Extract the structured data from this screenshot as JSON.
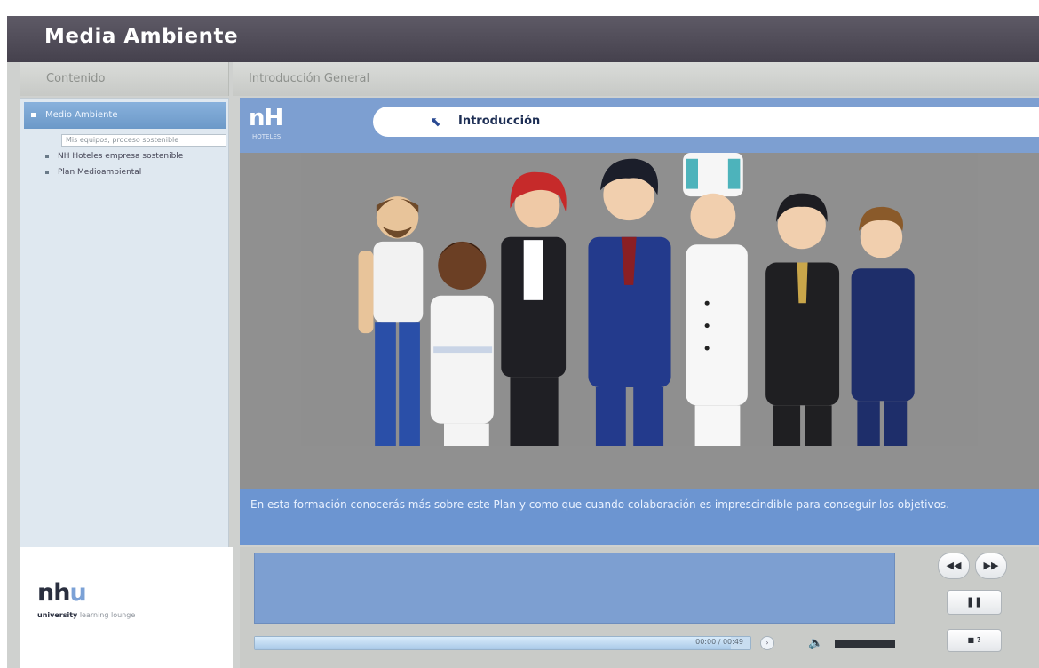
{
  "window": {
    "title": "Media Ambiente"
  },
  "sidebar": {
    "header": "Contenido",
    "root_label": "Medio Ambiente",
    "search_value": "Mis equipos, proceso sostenible",
    "items": [
      {
        "label": "NH Hoteles empresa sostenible"
      },
      {
        "label": "Plan Medioambiental"
      }
    ]
  },
  "content": {
    "header": "Introducción General",
    "breadcrumb": "Introducción",
    "caption": "En esta formación conocerás más sobre este Plan y como que cuando colaboración es imprescindible para conseguir los objetivos."
  },
  "branding": {
    "logo_text": "nh",
    "logo_accent": "u",
    "sub_bold": "university",
    "sub_rest": "learning lounge"
  },
  "player": {
    "time": "00:00 / 00:49",
    "progress": 0.96,
    "volume": 1.0,
    "prev_label": "◀◀",
    "next_label": "▶▶",
    "pause_label": "❚❚",
    "small_label": "■ ?"
  },
  "colors": {
    "titlebar": "#4f4b57",
    "accent_blue": "#7d9fd1",
    "sidebar_bg": "#dfe8f0"
  },
  "icons": {
    "breadcrumb": "arrow-icon",
    "volume": "speaker-icon"
  }
}
